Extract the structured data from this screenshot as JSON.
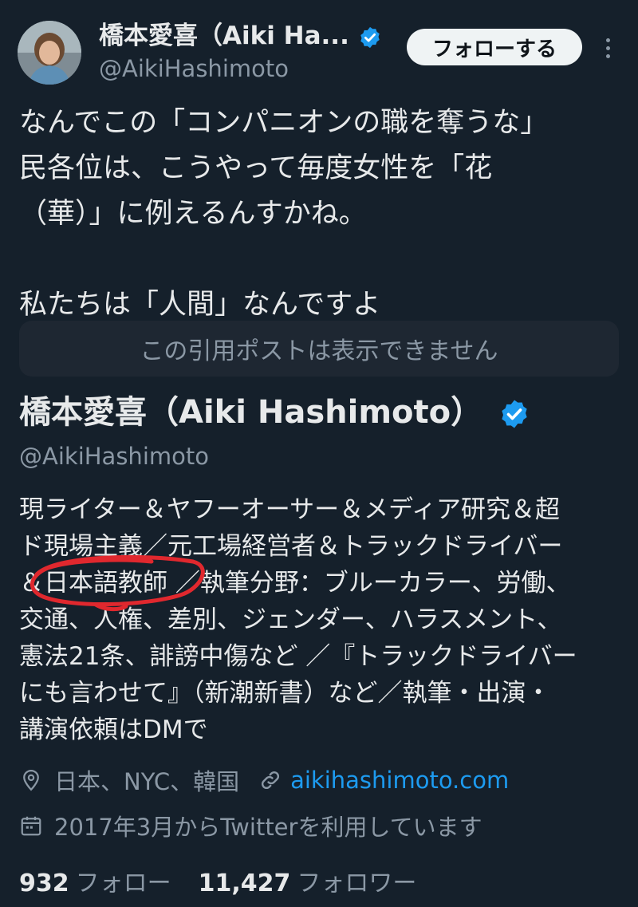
{
  "post": {
    "author_name": "橋本愛喜（Aiki Ha...",
    "handle": "@AikiHashimoto",
    "follow_label": "フォローする",
    "text": "なんでこの「コンパニオンの職を奪うな」\n民各位は、こうやって毎度女性を「花\n（華）」に例えるんすかね。\n\n私たちは「人間」なんですよ",
    "quote_unavailable": "この引用ポストは表示できません"
  },
  "profile": {
    "name": "橋本愛喜（Aiki Hashimoto）",
    "handle": "@AikiHashimoto",
    "bio": "現ライター＆ヤフーオーサー＆メディア研究＆超\nド現場主義／元工場経営者＆トラックドライバー\n＆日本語教師 ／執筆分野：ブルーカラー、労働、\n交通、人権、差別、ジェンダー、ハラスメント、\n憲法21条、誹謗中傷など ／『トラックドライバー\nにも言わせて』（新潮新書）など／執筆・出演・\n講演依頼はDMで",
    "location": "日本、NYC、韓国",
    "website": "aikihashimoto.com",
    "joined": "2017年3月からTwitterを利用しています",
    "following_count": "932",
    "following_label": "フォロー",
    "followers_count": "11,427",
    "followers_label": "フォロワー"
  },
  "icons": {
    "verified": "verified-badge-icon",
    "more": "more-options-icon",
    "location": "location-pin-icon",
    "link": "link-icon",
    "calendar": "calendar-icon"
  },
  "colors": {
    "background": "#15202b",
    "accent": "#1d9bf0",
    "annotation": "#e0282e"
  }
}
